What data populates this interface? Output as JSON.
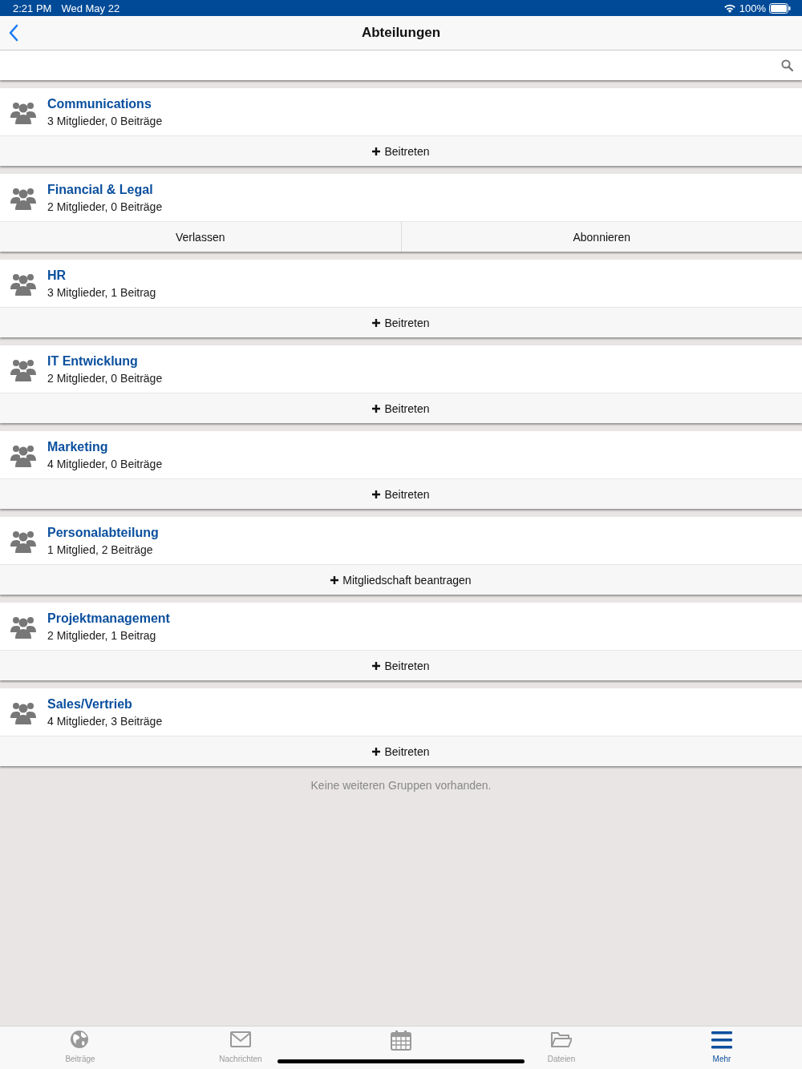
{
  "status_bar": {
    "time": "2:21 PM",
    "date": "Wed May 22",
    "battery": "100%"
  },
  "nav": {
    "title": "Abteilungen"
  },
  "groups": [
    {
      "name": "Communications",
      "meta": "3 Mitglieder, 0 Beiträge",
      "actions": [
        {
          "label": "Beitreten",
          "plus": true
        }
      ]
    },
    {
      "name": "Financial & Legal",
      "meta": "2 Mitglieder, 0 Beiträge",
      "actions": [
        {
          "label": "Verlassen",
          "plus": false
        },
        {
          "label": "Abonnieren",
          "plus": false
        }
      ]
    },
    {
      "name": "HR",
      "meta": "3 Mitglieder, 1 Beitrag",
      "actions": [
        {
          "label": "Beitreten",
          "plus": true
        }
      ]
    },
    {
      "name": "IT Entwicklung",
      "meta": "2 Mitglieder, 0 Beiträge",
      "actions": [
        {
          "label": "Beitreten",
          "plus": true
        }
      ]
    },
    {
      "name": "Marketing",
      "meta": "4 Mitglieder, 0 Beiträge",
      "actions": [
        {
          "label": "Beitreten",
          "plus": true
        }
      ]
    },
    {
      "name": "Personalabteilung",
      "meta": "1 Mitglied, 2 Beiträge",
      "actions": [
        {
          "label": "Mitgliedschaft beantragen",
          "plus": true
        }
      ]
    },
    {
      "name": "Projektmanagement",
      "meta": "2 Mitglieder, 1 Beitrag",
      "actions": [
        {
          "label": "Beitreten",
          "plus": true
        }
      ]
    },
    {
      "name": "Sales/Vertrieb",
      "meta": "4 Mitglieder, 3 Beiträge",
      "actions": [
        {
          "label": "Beitreten",
          "plus": true
        }
      ]
    }
  ],
  "footer_note": "Keine weiteren Gruppen vorhanden.",
  "tabs": [
    {
      "label": "Beiträge",
      "kind": "globe",
      "selected": false
    },
    {
      "label": "Nachrichten",
      "kind": "mail",
      "selected": false
    },
    {
      "kind": "calendar",
      "selected": false
    },
    {
      "label": "Dateien",
      "kind": "folder",
      "selected": false
    },
    {
      "label": "Mehr",
      "kind": "menu",
      "selected": true
    }
  ]
}
